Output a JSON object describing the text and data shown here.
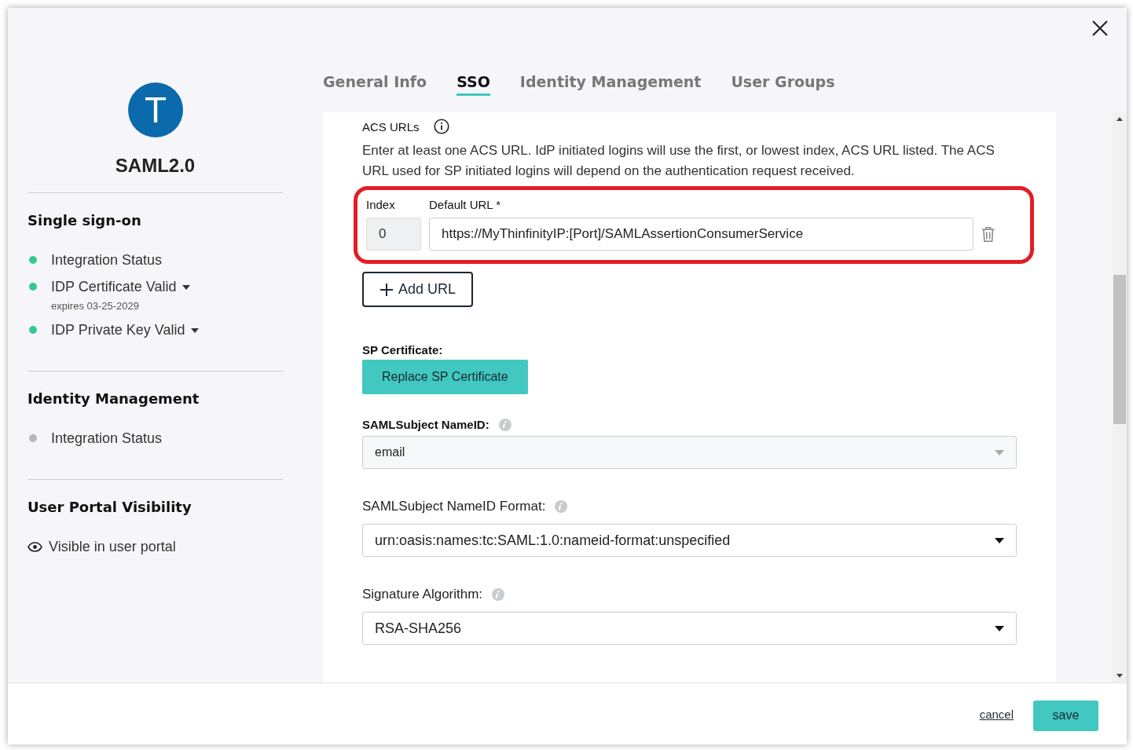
{
  "avatar": {
    "letter": "T"
  },
  "app_name": "SAML2.0",
  "sidebar": {
    "sections": [
      {
        "title": "Single sign-on",
        "items": [
          {
            "label": "Integration Status",
            "color": "#34c98e",
            "dropdown": false
          },
          {
            "label": "IDP Certificate Valid",
            "color": "#34c98e",
            "dropdown": true,
            "note": "expires 03-25-2029"
          },
          {
            "label": "IDP Private Key Valid",
            "color": "#34c98e",
            "dropdown": true
          }
        ]
      },
      {
        "title": "Identity Management",
        "items": [
          {
            "label": "Integration Status",
            "color": "#b7b7b7",
            "dropdown": false
          }
        ]
      }
    ],
    "visibility": {
      "title": "User Portal Visibility",
      "label": "Visible in user portal"
    }
  },
  "tabs": [
    {
      "label": "General Info",
      "selected": false
    },
    {
      "label": "SSO",
      "selected": true
    },
    {
      "label": "Identity Management",
      "selected": false
    },
    {
      "label": "User Groups",
      "selected": false
    }
  ],
  "acs": {
    "label": "ACS URLs",
    "description": "Enter at least one ACS URL. IdP initiated logins will use the first, or lowest index, ACS URL listed. The ACS URL used for SP initiated logins will depend on the authentication request received.",
    "index_label": "Index",
    "url_label": "Default URL *",
    "highlighted": true,
    "rows": [
      {
        "index": "0",
        "url": "https://MyThinfinityIP:[Port]/SAMLAssertionConsumerService"
      }
    ],
    "add_button": "Add URL"
  },
  "sp_certificate": {
    "label": "SP Certificate:",
    "button": "Replace SP Certificate"
  },
  "selects": [
    {
      "label": "SAMLSubject NameID:",
      "value": "email",
      "disabled": true
    },
    {
      "label": "SAMLSubject NameID Format:",
      "value": "urn:oasis:names:tc:SAML:1.0:nameid-format:unspecified",
      "disabled": false
    },
    {
      "label": "Signature Algorithm:",
      "value": "RSA-SHA256",
      "disabled": false
    }
  ],
  "footer": {
    "cancel": "cancel",
    "save": "save"
  }
}
